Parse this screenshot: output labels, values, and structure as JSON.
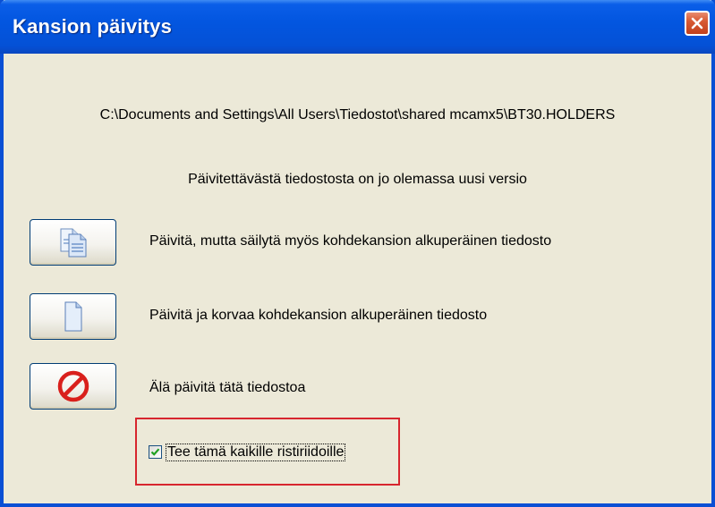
{
  "window": {
    "title": "Kansion päivitys"
  },
  "dialog": {
    "file_path": "C:\\Documents and Settings\\All Users\\Tiedostot\\shared mcamx5\\BT30.HOLDERS",
    "message": "Päivitettävästä tiedostosta on jo olemassa uusi versio",
    "options": [
      {
        "icon": "copy-documents-icon",
        "label": "Päivitä, mutta säilytä myös kohdekansion alkuperäinen tiedosto"
      },
      {
        "icon": "document-icon",
        "label": "Päivitä ja korvaa kohdekansion alkuperäinen tiedosto"
      },
      {
        "icon": "no-entry-icon",
        "label": "Älä päivitä tätä tiedostoa"
      }
    ],
    "apply_all": {
      "label": "Tee tämä kaikille ristiriidoille",
      "checked": true
    }
  },
  "colors": {
    "titlebar": "#0356e0",
    "dialog_bg": "#ece9d8",
    "close_button": "#d85a34",
    "highlight": "#d7262e",
    "checkmark": "#21a121"
  }
}
